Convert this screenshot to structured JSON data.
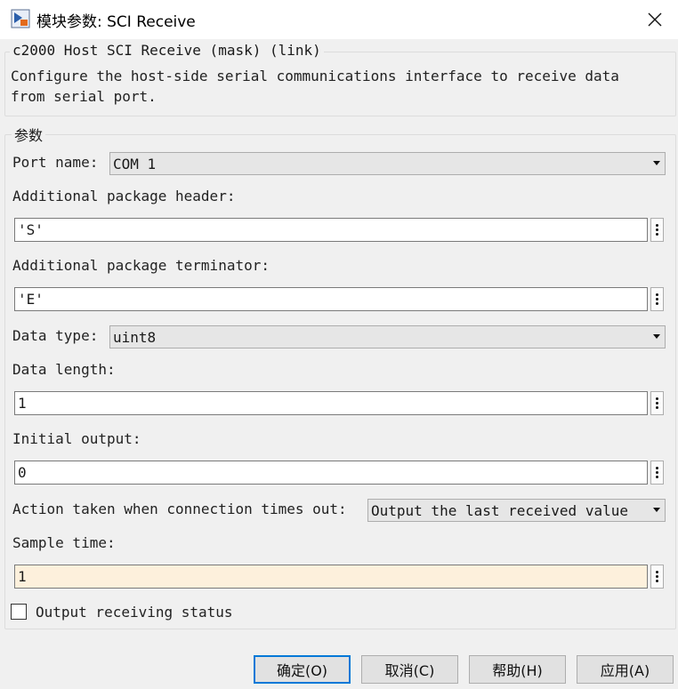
{
  "window": {
    "title": "模块参数: SCI Receive",
    "close_glyph": "✕"
  },
  "description": {
    "legend": "c2000 Host SCI Receive (mask) (link)",
    "line1": "Configure the host-side serial communications interface to receive data",
    "line2": "from serial port."
  },
  "params": {
    "legend": "参数",
    "port_name_label": "Port name:",
    "port_name_value": "COM 1",
    "header_label": "Additional package header:",
    "header_value": "'S'",
    "terminator_label": "Additional package terminator:",
    "terminator_value": "'E'",
    "data_type_label": "Data type:",
    "data_type_value": "uint8",
    "data_length_label": "Data length:",
    "data_length_value": "1",
    "initial_output_label": "Initial output:",
    "initial_output_value": "0",
    "timeout_label": "Action taken when connection times out:",
    "timeout_value": "Output the last received value",
    "sample_time_label": "Sample time:",
    "sample_time_value": "1",
    "status_label": "Output receiving status",
    "status_checked": false
  },
  "buttons": {
    "ok": "确定(O)",
    "cancel": "取消(C)",
    "help": "帮助(H)",
    "apply": "应用(A)"
  },
  "colors": {
    "accent": "#0078d7",
    "sample_time_bg": "#fdf0dc"
  }
}
